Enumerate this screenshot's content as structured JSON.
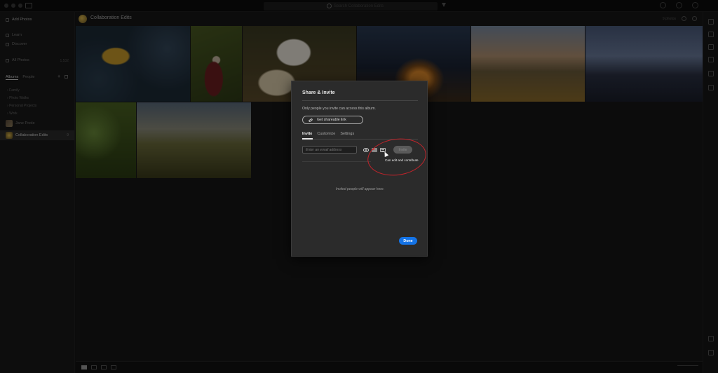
{
  "titlebar": {
    "search_placeholder": "Search Collaboration Edits"
  },
  "sidebar": {
    "add_photos": "Add Photos",
    "learn": "Learn",
    "discover": "Discover",
    "all_photos": "All Photos",
    "all_photos_count": "1,532",
    "tabs": {
      "albums": "Albums",
      "people": "People"
    },
    "folders": [
      "Family",
      "Photo Walks",
      "Personal Projects",
      "Work"
    ],
    "albums": [
      {
        "label": "Jane Poole",
        "count": ""
      },
      {
        "label": "Collaboration Edits",
        "count": "9"
      }
    ]
  },
  "header": {
    "album_title": "Collaboration Edits",
    "count_label": "9 photos"
  },
  "dialog": {
    "title": "Share & Invite",
    "description": "Only people you invite can access this album.",
    "shareable_link": "Get shareable link",
    "tabs": [
      "Invite",
      "Customize",
      "Settings"
    ],
    "email_placeholder": "Enter an email address",
    "invite_button": "Invite",
    "tooltip": "Can edit and contribute",
    "empty_message": "Invited people will appear here.",
    "done_button": "Done"
  },
  "colors": {
    "accent_blue": "#1473e6",
    "annotation_red": "#c0242b"
  }
}
